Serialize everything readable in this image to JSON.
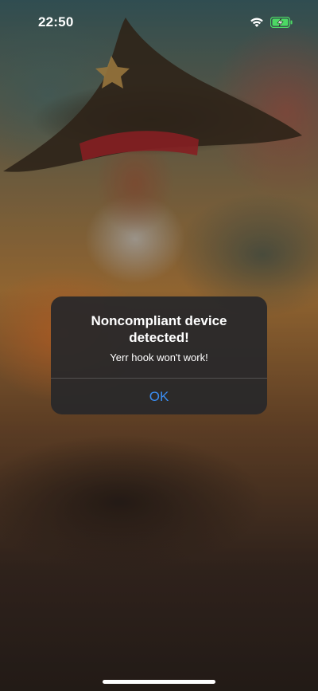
{
  "status_bar": {
    "time": "22:50",
    "icons": [
      "wifi-icon",
      "battery-charging-icon"
    ],
    "battery_color": "#4cd964"
  },
  "alert": {
    "title": "Noncompliant device detected!",
    "message": "Yerr hook won't work!",
    "button_label": "OK",
    "button_color": "#3a8cf0"
  },
  "background": {
    "description_icon": "pirate-painting-wallpaper"
  }
}
